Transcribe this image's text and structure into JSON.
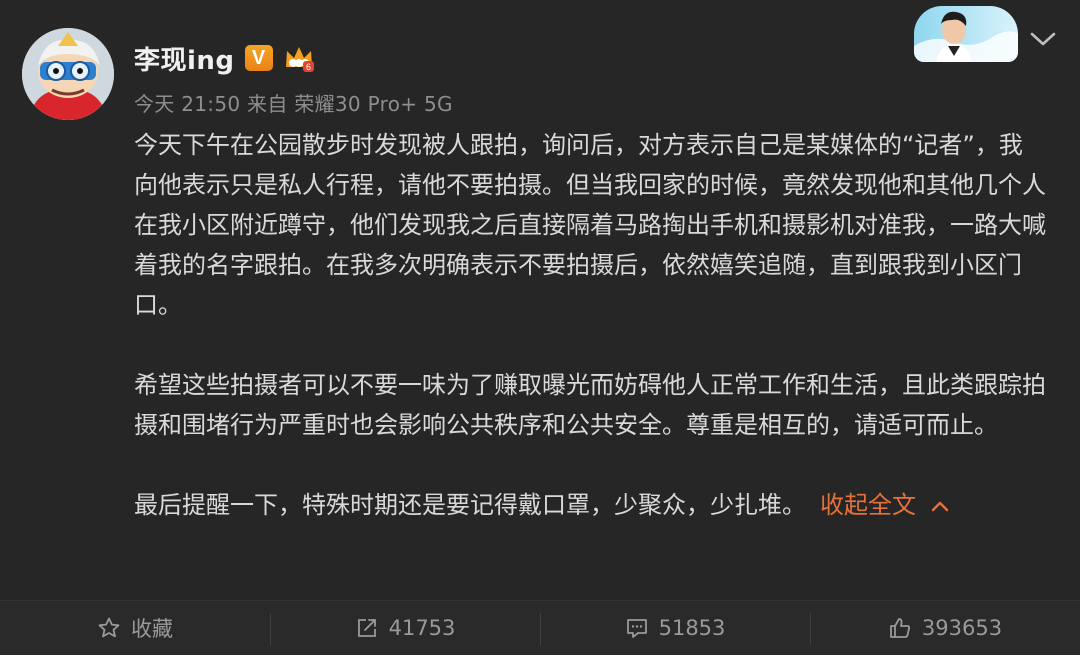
{
  "post": {
    "username": "李现ing",
    "verified_badge": "V",
    "meta": "今天 21:50 来自 荣耀30 Pro+ 5G",
    "paragraphs": [
      "今天下午在公园散步时发现被人跟拍，询问后，对方表示自己是某媒体的“记者”，我向他表示只是私人行程，请他不要拍摄。但当我回家的时候，竟然发现他和其他几个人在我小区附近蹲守，他们发现我之后直接隔着马路掏出手机和摄影机对准我，一路大喊着我的名字跟拍。在我多次明确表示不要拍摄后，依然嬉笑追随，直到跟我到小区门口。",
      "希望这些拍摄者可以不要一味为了赚取曝光而妨碍他人正常工作和生活，且此类跟踪拍摄和围堵行为严重时也会影响公共秩序和公共安全。尊重是相互的，请适可而止。",
      "最后提醒一下，特殊时期还是要记得戴口罩，少聚众，少扎堆。"
    ],
    "collapse_label": "收起全文",
    "collapse_chevron": "^",
    "icons": {
      "avatar": "cartoon-avatar",
      "badge": "verified-v-icon",
      "member": "crown-icon",
      "menu": "chevron-down-icon"
    }
  },
  "actions": {
    "favorite_label": "收藏",
    "repost_count": "41753",
    "comment_count": "51853",
    "like_count": "393653"
  },
  "colors": {
    "background": "#262626",
    "text": "#d9d9d9",
    "meta": "#8e8e8e",
    "accent": "#e8703a",
    "badge": "#f39c1f"
  }
}
